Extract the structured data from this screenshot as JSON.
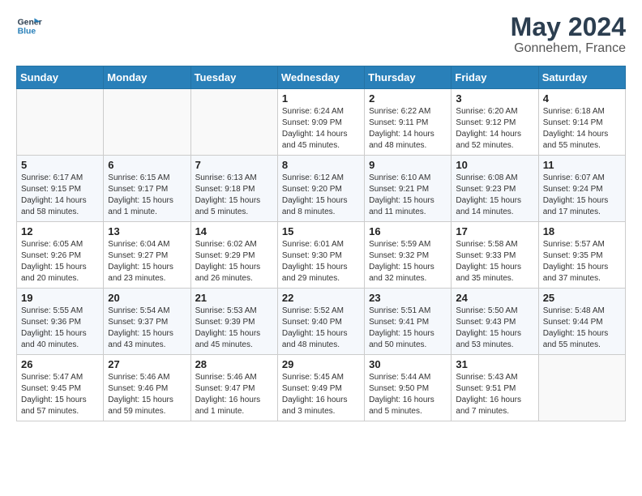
{
  "logo": {
    "line1": "General",
    "line2": "Blue"
  },
  "title": "May 2024",
  "location": "Gonnehem, France",
  "days_of_week": [
    "Sunday",
    "Monday",
    "Tuesday",
    "Wednesday",
    "Thursday",
    "Friday",
    "Saturday"
  ],
  "weeks": [
    [
      {
        "day": "",
        "info": ""
      },
      {
        "day": "",
        "info": ""
      },
      {
        "day": "",
        "info": ""
      },
      {
        "day": "1",
        "info": "Sunrise: 6:24 AM\nSunset: 9:09 PM\nDaylight: 14 hours\nand 45 minutes."
      },
      {
        "day": "2",
        "info": "Sunrise: 6:22 AM\nSunset: 9:11 PM\nDaylight: 14 hours\nand 48 minutes."
      },
      {
        "day": "3",
        "info": "Sunrise: 6:20 AM\nSunset: 9:12 PM\nDaylight: 14 hours\nand 52 minutes."
      },
      {
        "day": "4",
        "info": "Sunrise: 6:18 AM\nSunset: 9:14 PM\nDaylight: 14 hours\nand 55 minutes."
      }
    ],
    [
      {
        "day": "5",
        "info": "Sunrise: 6:17 AM\nSunset: 9:15 PM\nDaylight: 14 hours\nand 58 minutes."
      },
      {
        "day": "6",
        "info": "Sunrise: 6:15 AM\nSunset: 9:17 PM\nDaylight: 15 hours\nand 1 minute."
      },
      {
        "day": "7",
        "info": "Sunrise: 6:13 AM\nSunset: 9:18 PM\nDaylight: 15 hours\nand 5 minutes."
      },
      {
        "day": "8",
        "info": "Sunrise: 6:12 AM\nSunset: 9:20 PM\nDaylight: 15 hours\nand 8 minutes."
      },
      {
        "day": "9",
        "info": "Sunrise: 6:10 AM\nSunset: 9:21 PM\nDaylight: 15 hours\nand 11 minutes."
      },
      {
        "day": "10",
        "info": "Sunrise: 6:08 AM\nSunset: 9:23 PM\nDaylight: 15 hours\nand 14 minutes."
      },
      {
        "day": "11",
        "info": "Sunrise: 6:07 AM\nSunset: 9:24 PM\nDaylight: 15 hours\nand 17 minutes."
      }
    ],
    [
      {
        "day": "12",
        "info": "Sunrise: 6:05 AM\nSunset: 9:26 PM\nDaylight: 15 hours\nand 20 minutes."
      },
      {
        "day": "13",
        "info": "Sunrise: 6:04 AM\nSunset: 9:27 PM\nDaylight: 15 hours\nand 23 minutes."
      },
      {
        "day": "14",
        "info": "Sunrise: 6:02 AM\nSunset: 9:29 PM\nDaylight: 15 hours\nand 26 minutes."
      },
      {
        "day": "15",
        "info": "Sunrise: 6:01 AM\nSunset: 9:30 PM\nDaylight: 15 hours\nand 29 minutes."
      },
      {
        "day": "16",
        "info": "Sunrise: 5:59 AM\nSunset: 9:32 PM\nDaylight: 15 hours\nand 32 minutes."
      },
      {
        "day": "17",
        "info": "Sunrise: 5:58 AM\nSunset: 9:33 PM\nDaylight: 15 hours\nand 35 minutes."
      },
      {
        "day": "18",
        "info": "Sunrise: 5:57 AM\nSunset: 9:35 PM\nDaylight: 15 hours\nand 37 minutes."
      }
    ],
    [
      {
        "day": "19",
        "info": "Sunrise: 5:55 AM\nSunset: 9:36 PM\nDaylight: 15 hours\nand 40 minutes."
      },
      {
        "day": "20",
        "info": "Sunrise: 5:54 AM\nSunset: 9:37 PM\nDaylight: 15 hours\nand 43 minutes."
      },
      {
        "day": "21",
        "info": "Sunrise: 5:53 AM\nSunset: 9:39 PM\nDaylight: 15 hours\nand 45 minutes."
      },
      {
        "day": "22",
        "info": "Sunrise: 5:52 AM\nSunset: 9:40 PM\nDaylight: 15 hours\nand 48 minutes."
      },
      {
        "day": "23",
        "info": "Sunrise: 5:51 AM\nSunset: 9:41 PM\nDaylight: 15 hours\nand 50 minutes."
      },
      {
        "day": "24",
        "info": "Sunrise: 5:50 AM\nSunset: 9:43 PM\nDaylight: 15 hours\nand 53 minutes."
      },
      {
        "day": "25",
        "info": "Sunrise: 5:48 AM\nSunset: 9:44 PM\nDaylight: 15 hours\nand 55 minutes."
      }
    ],
    [
      {
        "day": "26",
        "info": "Sunrise: 5:47 AM\nSunset: 9:45 PM\nDaylight: 15 hours\nand 57 minutes."
      },
      {
        "day": "27",
        "info": "Sunrise: 5:46 AM\nSunset: 9:46 PM\nDaylight: 15 hours\nand 59 minutes."
      },
      {
        "day": "28",
        "info": "Sunrise: 5:46 AM\nSunset: 9:47 PM\nDaylight: 16 hours\nand 1 minute."
      },
      {
        "day": "29",
        "info": "Sunrise: 5:45 AM\nSunset: 9:49 PM\nDaylight: 16 hours\nand 3 minutes."
      },
      {
        "day": "30",
        "info": "Sunrise: 5:44 AM\nSunset: 9:50 PM\nDaylight: 16 hours\nand 5 minutes."
      },
      {
        "day": "31",
        "info": "Sunrise: 5:43 AM\nSunset: 9:51 PM\nDaylight: 16 hours\nand 7 minutes."
      },
      {
        "day": "",
        "info": ""
      }
    ]
  ]
}
